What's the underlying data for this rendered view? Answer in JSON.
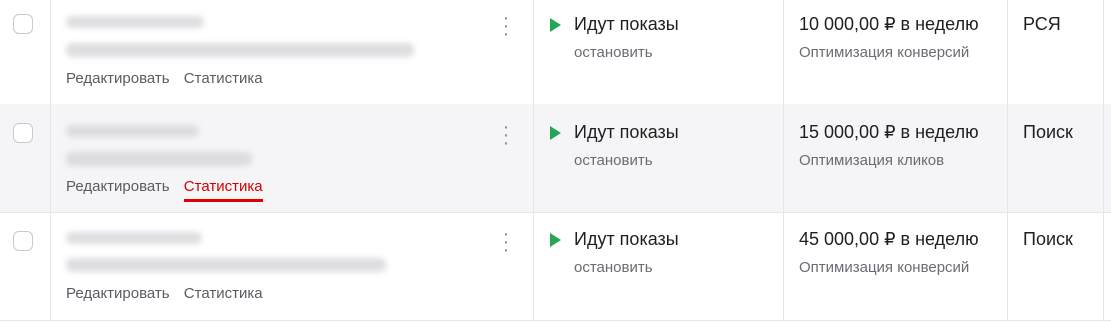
{
  "rows": [
    {
      "edit_label": "Редактировать",
      "stats_label": "Статистика",
      "status": "Идут показы",
      "stop_label": "остановить",
      "budget": "10 000,00 ₽ в неделю",
      "strategy": "Оптимизация конверсий",
      "type": "РСЯ"
    },
    {
      "edit_label": "Редактировать",
      "stats_label": "Статистика",
      "status": "Идут показы",
      "stop_label": "остановить",
      "budget": "15 000,00 ₽ в неделю",
      "strategy": "Оптимизация кликов",
      "type": "Поиск"
    },
    {
      "edit_label": "Редактировать",
      "stats_label": "Статистика",
      "status": "Идут показы",
      "stop_label": "остановить",
      "budget": "45 000,00 ₽ в неделю",
      "strategy": "Оптимизация конверсий",
      "type": "Поиск"
    }
  ],
  "colors": {
    "status_play": "#24a658",
    "active_link": "#d40000"
  },
  "icons": {
    "status": "play-icon",
    "menu": "more-vertical-icon"
  }
}
